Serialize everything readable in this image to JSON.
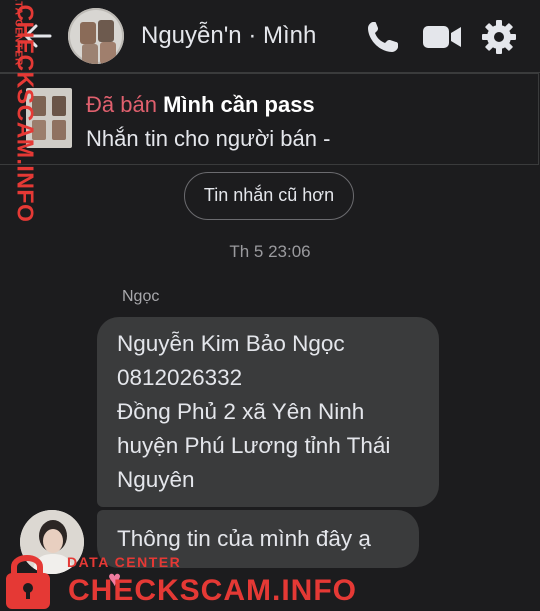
{
  "header": {
    "contact_name": "Nguyễn'n · Mình"
  },
  "listing": {
    "status": "Đã bán",
    "title": "Mình cần pass",
    "subtitle": "Nhắn tin cho người bán -"
  },
  "conversation": {
    "older_messages_label": "Tin nhắn cũ hơn",
    "timestamp": "Th 5 23:06",
    "sender_name": "Ngọc",
    "messages": [
      {
        "lines": [
          "Nguyễn Kim Bảo Ngọc",
          "0812026332",
          "Đồng Phủ 2 xã Yên Ninh",
          "huyện Phú Lương tỉnh Thái",
          "Nguyên"
        ]
      },
      {
        "lines": [
          "Thông tin của mình đây ạ"
        ]
      }
    ],
    "reaction": "heart"
  },
  "watermark": {
    "brand": "CHECKSCAM.INFO",
    "tagline": "DATA CENTER",
    "color": "#e53935"
  },
  "colors": {
    "background": "#1c1c1e",
    "bubble": "#3a3b3c",
    "sold_status": "#e0606e"
  }
}
